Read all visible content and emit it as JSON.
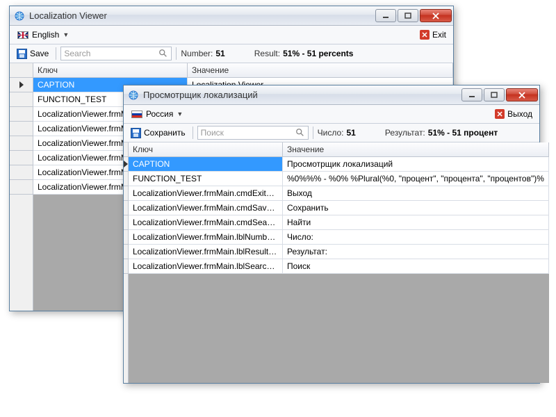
{
  "win_en": {
    "title": "Localization Viewer",
    "language": "English",
    "exit": "Exit",
    "save": "Save",
    "search_placeholder": "Search",
    "number_label": "Number:",
    "number_value": "51",
    "result_label": "Result:",
    "result_value": "51% - 51 percents",
    "col_key": "Ключ",
    "col_value": "Значение",
    "rows": [
      {
        "key": "CAPTION",
        "value": "Localization Viewer"
      },
      {
        "key": "FUNCTION_TEST",
        "value": ""
      },
      {
        "key": "LocalizationViewer.frmMain",
        "value": ""
      },
      {
        "key": "LocalizationViewer.frmMain",
        "value": ""
      },
      {
        "key": "LocalizationViewer.frmMain",
        "value": ""
      },
      {
        "key": "LocalizationViewer.frmMain",
        "value": ""
      },
      {
        "key": "LocalizationViewer.frmMain",
        "value": ""
      },
      {
        "key": "LocalizationViewer.frmMain",
        "value": ""
      }
    ]
  },
  "win_ru": {
    "title": "Просмотрщик локализаций",
    "language": "Россия",
    "exit": "Выход",
    "save": "Сохранить",
    "search_placeholder": "Поиск",
    "number_label": "Число:",
    "number_value": "51",
    "result_label": "Результат:",
    "result_value": "51% - 51 процент",
    "col_key": "Ключ",
    "col_value": "Значение",
    "rows": [
      {
        "key": "CAPTION",
        "value": "Просмотрщик локализаций"
      },
      {
        "key": "FUNCTION_TEST",
        "value": "%0%%% - %0% %Plural(%0, \"процент\", \"процента\", \"процентов\")%"
      },
      {
        "key": "LocalizationViewer.frmMain.cmdExit_Text",
        "value": "Выход"
      },
      {
        "key": "LocalizationViewer.frmMain.cmdSave_Text",
        "value": "Сохранить"
      },
      {
        "key": "LocalizationViewer.frmMain.cmdSearch_Text",
        "value": "Найти"
      },
      {
        "key": "LocalizationViewer.frmMain.lblNumber_Text",
        "value": "Число:"
      },
      {
        "key": "LocalizationViewer.frmMain.lblResult_Text",
        "value": "Результат:"
      },
      {
        "key": "LocalizationViewer.frmMain.lblSearch_Text",
        "value": "Поиск"
      }
    ]
  }
}
